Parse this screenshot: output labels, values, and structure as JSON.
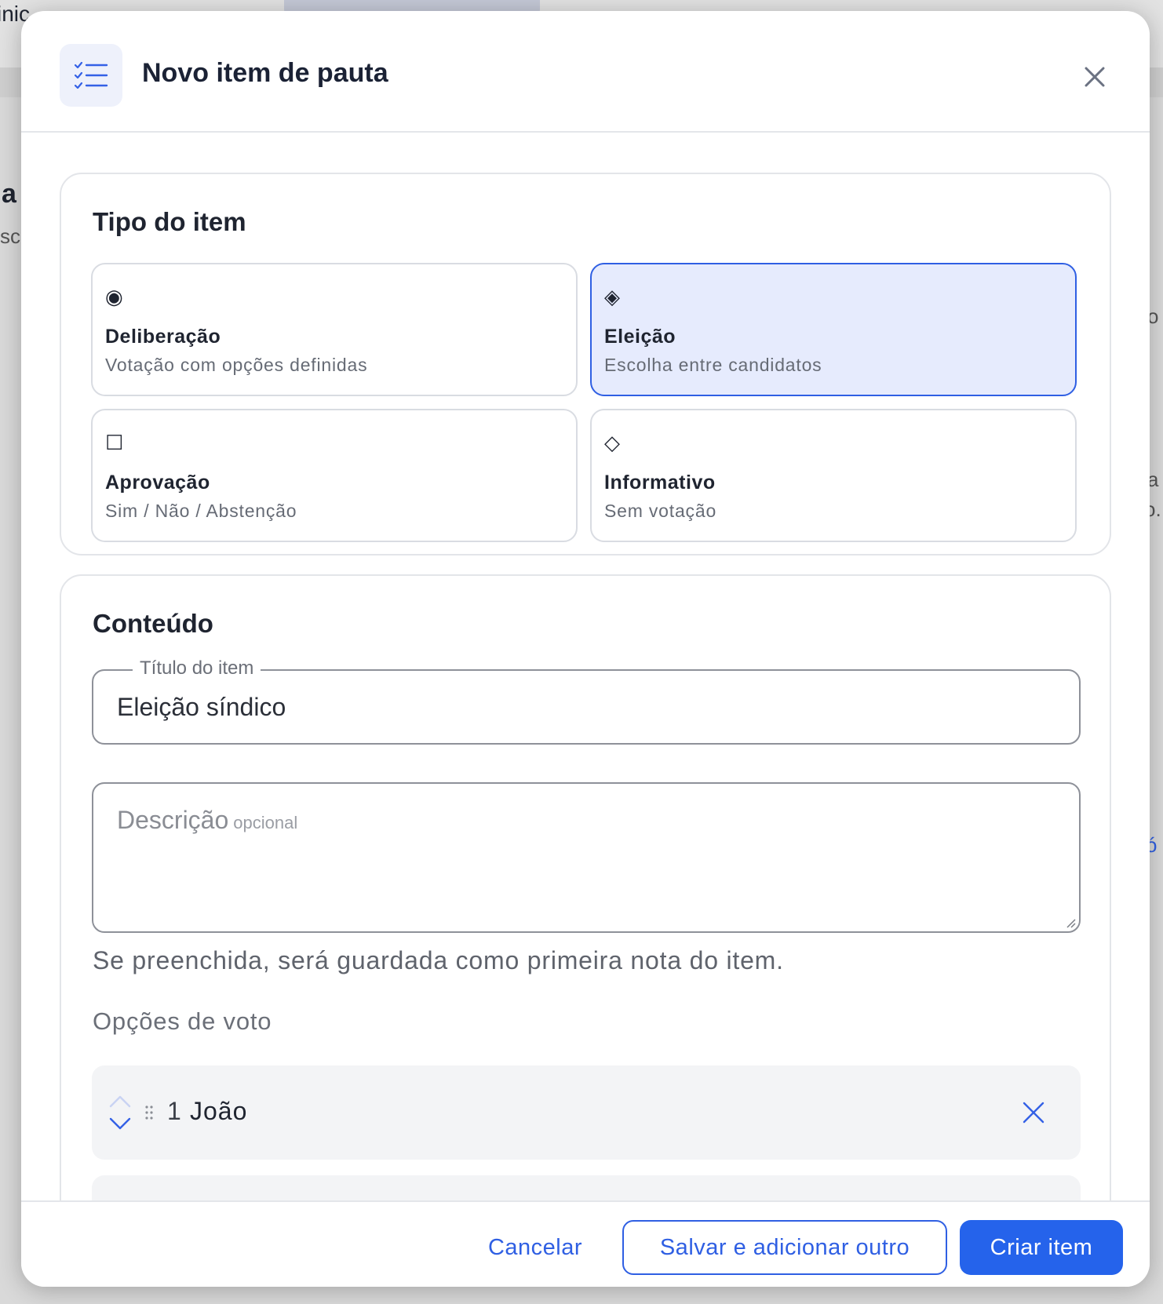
{
  "background": {
    "fragments": [
      "inic",
      "a",
      "sc",
      "o",
      "a",
      "o.",
      "ó"
    ]
  },
  "modal": {
    "title": "Novo item de pauta",
    "header_icon": "checklist-icon",
    "close_icon": "close-icon"
  },
  "item_type": {
    "title": "Tipo do item",
    "selected": "Eleição",
    "options": [
      {
        "glyph": "◉",
        "icon": "radio-icon",
        "label": "Deliberação",
        "description": "Votação com opções definidas"
      },
      {
        "glyph": "◈",
        "icon": "diamond-filled-icon",
        "label": "Eleição",
        "description": "Escolha entre candidatos"
      },
      {
        "glyph": "☐",
        "icon": "square-icon",
        "label": "Aprovação",
        "description": "Sim / Não / Abstenção"
      },
      {
        "glyph": "◇",
        "icon": "diamond-outline-icon",
        "label": "Informativo",
        "description": "Sem votação"
      }
    ]
  },
  "content": {
    "title": "Conteúdo",
    "title_field": {
      "label": "Título do item",
      "value": "Eleição síndico"
    },
    "description_field": {
      "placeholder": "Descrição",
      "optional_hint": "opcional"
    },
    "helper_text": "Se preenchida, será guardada como primeira nota do item.",
    "vote_options_label": "Opções de voto",
    "vote_options": [
      {
        "number": "1",
        "name": "João"
      }
    ]
  },
  "footer": {
    "cancel_label": "Cancelar",
    "save_add_label": "Salvar e adicionar outro",
    "create_label": "Criar item"
  },
  "colors": {
    "accent": "#2f5fe3",
    "primary_button": "#2563eb",
    "selected_bg": "#e6ebfd",
    "option_bg": "#f3f4f6"
  }
}
